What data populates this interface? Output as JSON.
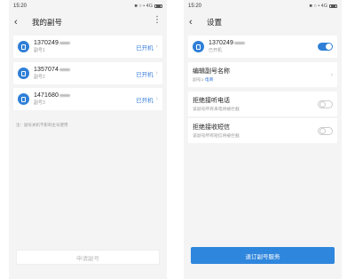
{
  "left": {
    "status_time": "15:20",
    "status_right": "■ ○ • 4G",
    "title": "我的副号",
    "numbers": [
      {
        "number": "1370249",
        "label": "副号1",
        "status": "已开机"
      },
      {
        "number": "1357074",
        "label": "副号2",
        "status": "已开机"
      },
      {
        "number": "1471680",
        "label": "副号3",
        "status": "已开机"
      }
    ],
    "note": "注：副号关机不影响主号使用",
    "apply_label": "申请副号"
  },
  "right": {
    "status_time": "15:20",
    "status_right": "■ ○ • 4G",
    "title": "设置",
    "number": "1370249",
    "number_status": "已开机",
    "rows": [
      {
        "title": "编辑副号名称",
        "desc_prefix": "副号1-",
        "desc_highlight": "电商"
      },
      {
        "title": "拒绝接听电话",
        "desc": "该副号所有来电将被拦截"
      },
      {
        "title": "拒绝接收短信",
        "desc": "该副号所有短信将被拦截"
      }
    ],
    "button_label": "退订副号服务"
  },
  "icons": {
    "back": "back-arrow-icon",
    "more": "more-vertical-icon",
    "sim": "sim-card-icon",
    "chevron": "chevron-right-icon"
  },
  "colors": {
    "accent": "#2f7fd6",
    "status_text": "#3a7fdc"
  }
}
